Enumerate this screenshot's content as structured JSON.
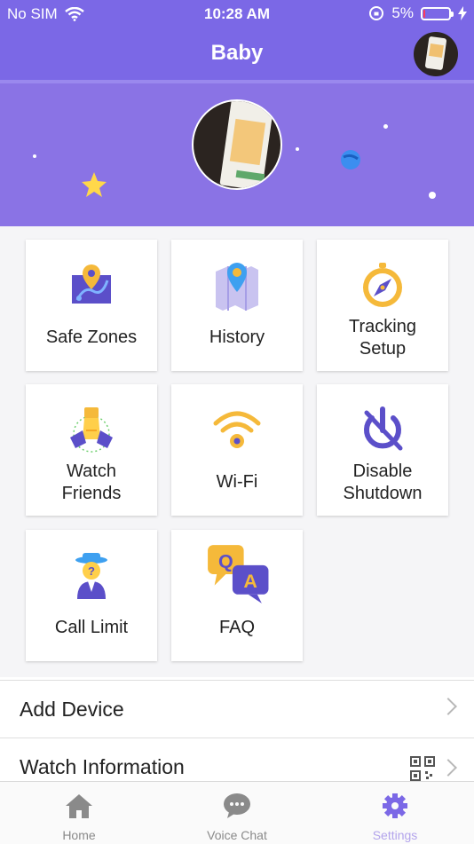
{
  "status_bar": {
    "carrier": "No SIM",
    "time": "10:28 AM",
    "battery": "5%"
  },
  "nav": {
    "title": "Baby"
  },
  "tiles": [
    {
      "label": "Safe Zones",
      "icon": "map-pin-icon"
    },
    {
      "label": "History",
      "icon": "location-map-icon"
    },
    {
      "label": "Tracking Setup",
      "icon": "compass-icon"
    },
    {
      "label": "Watch Friends",
      "icon": "handshake-icon"
    },
    {
      "label": "Wi-Fi",
      "icon": "wifi-icon"
    },
    {
      "label": "Disable Shutdown",
      "icon": "power-off-icon"
    },
    {
      "label": "Call Limit",
      "icon": "detective-icon"
    },
    {
      "label": "FAQ",
      "icon": "qa-bubbles-icon"
    }
  ],
  "tile_label_lines": {
    "tracking": [
      "Tracking",
      "Setup"
    ],
    "friends": [
      "Watch",
      "Friends"
    ],
    "shutdown": [
      "Disable",
      "Shutdown"
    ]
  },
  "list": {
    "add_device": "Add Device",
    "watch_information": "Watch Information"
  },
  "tabs": {
    "home": "Home",
    "voice_chat": "Voice Chat",
    "settings": "Settings"
  },
  "colors": {
    "header": "#7b68e6",
    "banner": "#8a73e5",
    "active_tab": "#b3a4ec",
    "inactive_tab": "#8a8a8a"
  }
}
